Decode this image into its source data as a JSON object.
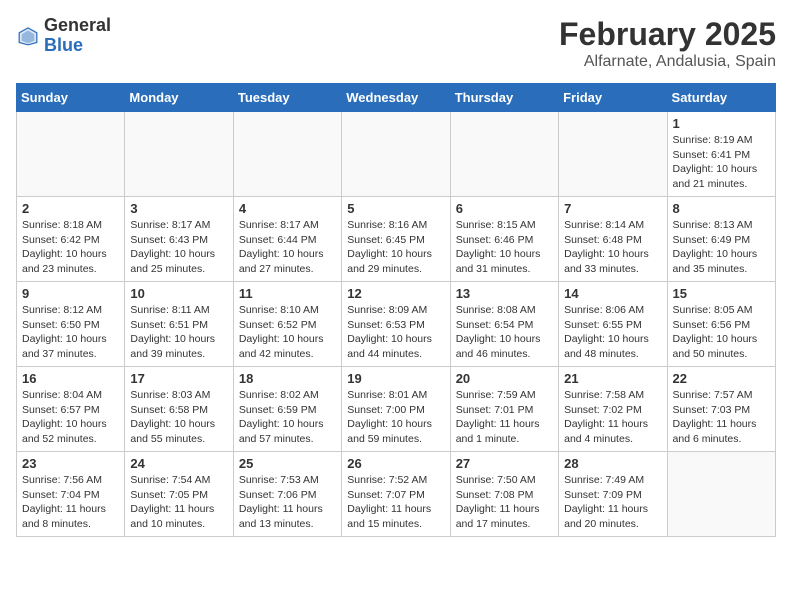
{
  "header": {
    "logo_general": "General",
    "logo_blue": "Blue",
    "title": "February 2025",
    "subtitle": "Alfarnate, Andalusia, Spain"
  },
  "weekdays": [
    "Sunday",
    "Monday",
    "Tuesday",
    "Wednesday",
    "Thursday",
    "Friday",
    "Saturday"
  ],
  "weeks": [
    [
      {
        "day": "",
        "info": ""
      },
      {
        "day": "",
        "info": ""
      },
      {
        "day": "",
        "info": ""
      },
      {
        "day": "",
        "info": ""
      },
      {
        "day": "",
        "info": ""
      },
      {
        "day": "",
        "info": ""
      },
      {
        "day": "1",
        "info": "Sunrise: 8:19 AM\nSunset: 6:41 PM\nDaylight: 10 hours\nand 21 minutes."
      }
    ],
    [
      {
        "day": "2",
        "info": "Sunrise: 8:18 AM\nSunset: 6:42 PM\nDaylight: 10 hours\nand 23 minutes."
      },
      {
        "day": "3",
        "info": "Sunrise: 8:17 AM\nSunset: 6:43 PM\nDaylight: 10 hours\nand 25 minutes."
      },
      {
        "day": "4",
        "info": "Sunrise: 8:17 AM\nSunset: 6:44 PM\nDaylight: 10 hours\nand 27 minutes."
      },
      {
        "day": "5",
        "info": "Sunrise: 8:16 AM\nSunset: 6:45 PM\nDaylight: 10 hours\nand 29 minutes."
      },
      {
        "day": "6",
        "info": "Sunrise: 8:15 AM\nSunset: 6:46 PM\nDaylight: 10 hours\nand 31 minutes."
      },
      {
        "day": "7",
        "info": "Sunrise: 8:14 AM\nSunset: 6:48 PM\nDaylight: 10 hours\nand 33 minutes."
      },
      {
        "day": "8",
        "info": "Sunrise: 8:13 AM\nSunset: 6:49 PM\nDaylight: 10 hours\nand 35 minutes."
      }
    ],
    [
      {
        "day": "9",
        "info": "Sunrise: 8:12 AM\nSunset: 6:50 PM\nDaylight: 10 hours\nand 37 minutes."
      },
      {
        "day": "10",
        "info": "Sunrise: 8:11 AM\nSunset: 6:51 PM\nDaylight: 10 hours\nand 39 minutes."
      },
      {
        "day": "11",
        "info": "Sunrise: 8:10 AM\nSunset: 6:52 PM\nDaylight: 10 hours\nand 42 minutes."
      },
      {
        "day": "12",
        "info": "Sunrise: 8:09 AM\nSunset: 6:53 PM\nDaylight: 10 hours\nand 44 minutes."
      },
      {
        "day": "13",
        "info": "Sunrise: 8:08 AM\nSunset: 6:54 PM\nDaylight: 10 hours\nand 46 minutes."
      },
      {
        "day": "14",
        "info": "Sunrise: 8:06 AM\nSunset: 6:55 PM\nDaylight: 10 hours\nand 48 minutes."
      },
      {
        "day": "15",
        "info": "Sunrise: 8:05 AM\nSunset: 6:56 PM\nDaylight: 10 hours\nand 50 minutes."
      }
    ],
    [
      {
        "day": "16",
        "info": "Sunrise: 8:04 AM\nSunset: 6:57 PM\nDaylight: 10 hours\nand 52 minutes."
      },
      {
        "day": "17",
        "info": "Sunrise: 8:03 AM\nSunset: 6:58 PM\nDaylight: 10 hours\nand 55 minutes."
      },
      {
        "day": "18",
        "info": "Sunrise: 8:02 AM\nSunset: 6:59 PM\nDaylight: 10 hours\nand 57 minutes."
      },
      {
        "day": "19",
        "info": "Sunrise: 8:01 AM\nSunset: 7:00 PM\nDaylight: 10 hours\nand 59 minutes."
      },
      {
        "day": "20",
        "info": "Sunrise: 7:59 AM\nSunset: 7:01 PM\nDaylight: 11 hours\nand 1 minute."
      },
      {
        "day": "21",
        "info": "Sunrise: 7:58 AM\nSunset: 7:02 PM\nDaylight: 11 hours\nand 4 minutes."
      },
      {
        "day": "22",
        "info": "Sunrise: 7:57 AM\nSunset: 7:03 PM\nDaylight: 11 hours\nand 6 minutes."
      }
    ],
    [
      {
        "day": "23",
        "info": "Sunrise: 7:56 AM\nSunset: 7:04 PM\nDaylight: 11 hours\nand 8 minutes."
      },
      {
        "day": "24",
        "info": "Sunrise: 7:54 AM\nSunset: 7:05 PM\nDaylight: 11 hours\nand 10 minutes."
      },
      {
        "day": "25",
        "info": "Sunrise: 7:53 AM\nSunset: 7:06 PM\nDaylight: 11 hours\nand 13 minutes."
      },
      {
        "day": "26",
        "info": "Sunrise: 7:52 AM\nSunset: 7:07 PM\nDaylight: 11 hours\nand 15 minutes."
      },
      {
        "day": "27",
        "info": "Sunrise: 7:50 AM\nSunset: 7:08 PM\nDaylight: 11 hours\nand 17 minutes."
      },
      {
        "day": "28",
        "info": "Sunrise: 7:49 AM\nSunset: 7:09 PM\nDaylight: 11 hours\nand 20 minutes."
      },
      {
        "day": "",
        "info": ""
      }
    ]
  ]
}
